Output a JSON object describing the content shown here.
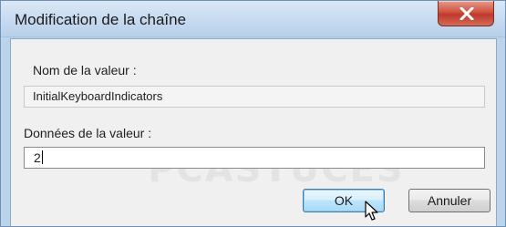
{
  "window": {
    "title": "Modification de la chaîne",
    "close_icon": "close-icon",
    "close_color": "#c7402e"
  },
  "form": {
    "name_label": "Nom de la valeur :",
    "name_value": "InitialKeyboardIndicators",
    "data_label": "Données de la valeur :",
    "data_value": "2"
  },
  "buttons": {
    "ok_label": "OK",
    "cancel_label": "Annuler"
  },
  "watermark": "PCASTUCES",
  "cursor_icon": "mouse-pointer-icon"
}
